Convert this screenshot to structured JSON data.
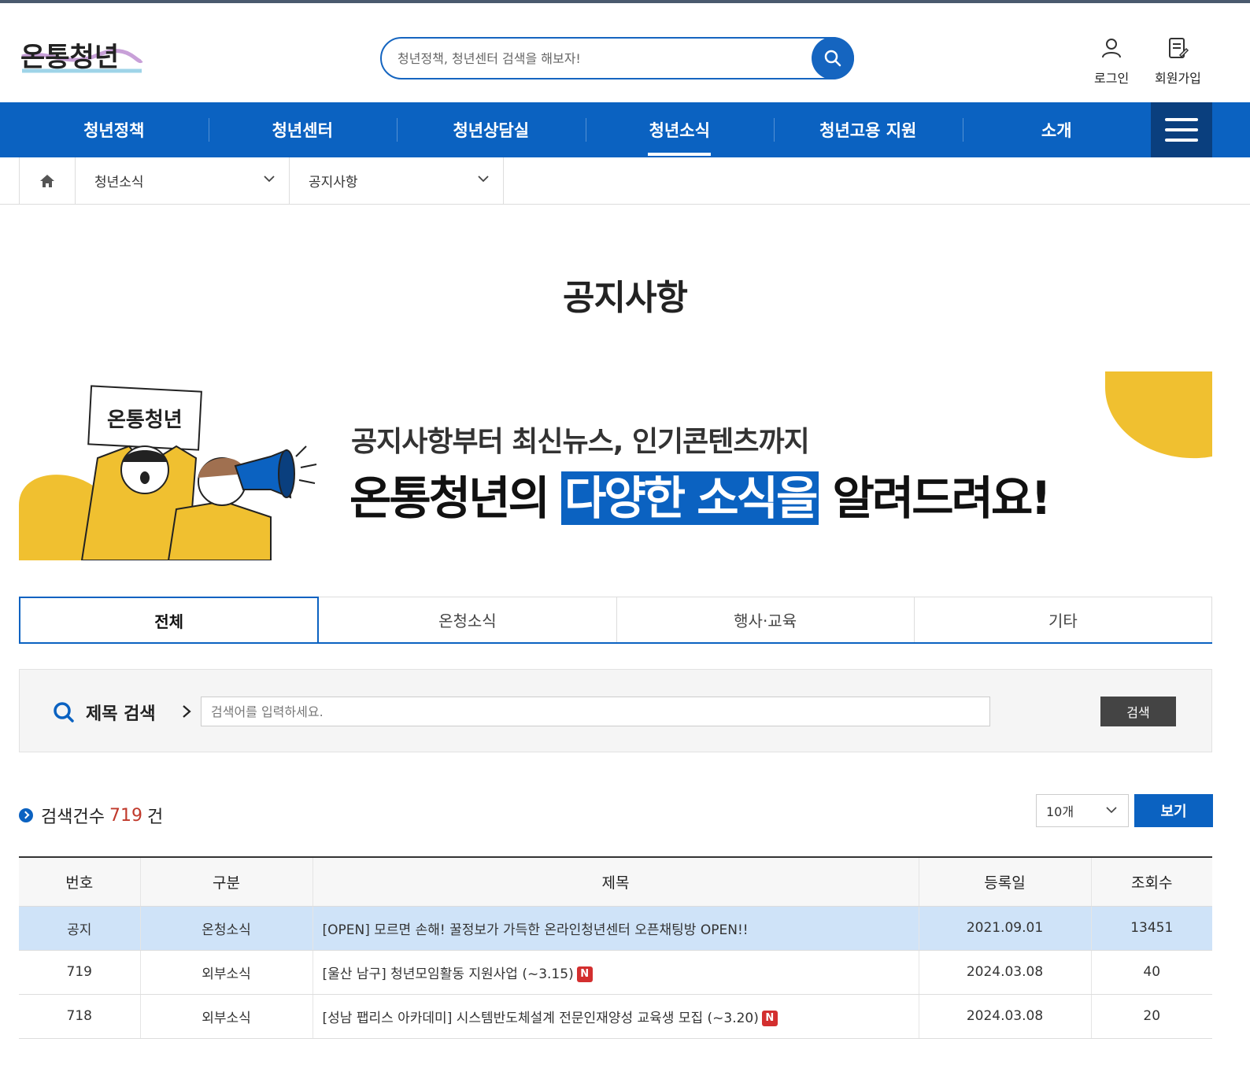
{
  "header": {
    "logo_text": "온통청년",
    "search_placeholder": "청년정책, 청년센터 검색을 해보자!",
    "login_label": "로그인",
    "signup_label": "회원가입"
  },
  "nav": {
    "items": [
      {
        "label": "청년정책"
      },
      {
        "label": "청년센터"
      },
      {
        "label": "청년상담실"
      },
      {
        "label": "청년소식"
      },
      {
        "label": "청년고용 지원"
      },
      {
        "label": "소개"
      }
    ]
  },
  "location": {
    "depth1": "청년소식",
    "depth2": "공지사항"
  },
  "page": {
    "title": "공지사항"
  },
  "banner": {
    "sign_text": "온통청년",
    "subtitle": "공지사항부터 최신뉴스, 인기콘텐츠까지",
    "main_before": "온통청년의 ",
    "main_highlight": "다양한 소식을",
    "main_after": " 알려드려요!"
  },
  "tabs": [
    {
      "label": "전체"
    },
    {
      "label": "온청소식"
    },
    {
      "label": "행사·교육"
    },
    {
      "label": "기타"
    }
  ],
  "search": {
    "label": "제목 검색",
    "placeholder": "검색어를 입력하세요.",
    "button": "검색"
  },
  "results": {
    "prefix": "검색건수",
    "count": "719",
    "suffix": "건",
    "per_page": "10개",
    "view_button": "보기"
  },
  "table": {
    "headers": [
      "번호",
      "구분",
      "제목",
      "등록일",
      "조회수"
    ],
    "rows": [
      {
        "no": "공지",
        "category": "온청소식",
        "title": "[OPEN] 모르면 손해! 꿀정보가 가득한 온라인청년센터 오픈채팅방 OPEN!!",
        "date": "2021.09.01",
        "views": "13451",
        "new": ""
      },
      {
        "no": "719",
        "category": "외부소식",
        "title": "[울산 남구] 청년모임활동 지원사업 (~3.15)",
        "date": "2024.03.08",
        "views": "40",
        "new": "N"
      },
      {
        "no": "718",
        "category": "외부소식",
        "title": "[성남 팹리스 아카데미] 시스템반도체설계 전문인재양성 교육생 모집 (~3.20)",
        "date": "2024.03.08",
        "views": "20",
        "new": "N"
      }
    ]
  },
  "colors": {
    "primary": "#0b62c1",
    "nav_dark": "#0a3f7e",
    "accent_yellow": "#f0c030",
    "notice_row": "#cfe3f8",
    "count_red": "#c0392b"
  }
}
